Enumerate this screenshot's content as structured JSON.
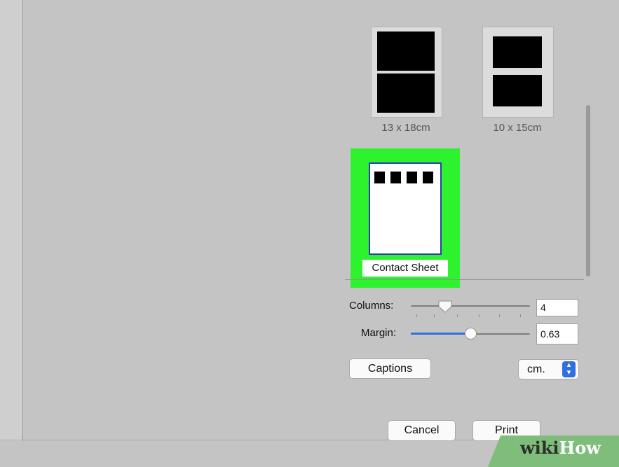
{
  "layouts": [
    {
      "label": "13 x 18cm"
    },
    {
      "label": "10 x 15cm"
    },
    {
      "label": "Contact Sheet"
    }
  ],
  "controls": {
    "columns": {
      "label": "Columns:",
      "value": "4"
    },
    "margin": {
      "label": "Margin:",
      "value": "0.63"
    }
  },
  "captions_label": "Captions",
  "unit": {
    "selected": "cm."
  },
  "buttons": {
    "cancel": "Cancel",
    "print": "Print"
  },
  "watermark": {
    "wiki": "wiki",
    "how": "How"
  },
  "colors": {
    "highlight": "#2ef22e",
    "accent": "#2f6fe0",
    "selection_border": "#2a3fb0"
  }
}
